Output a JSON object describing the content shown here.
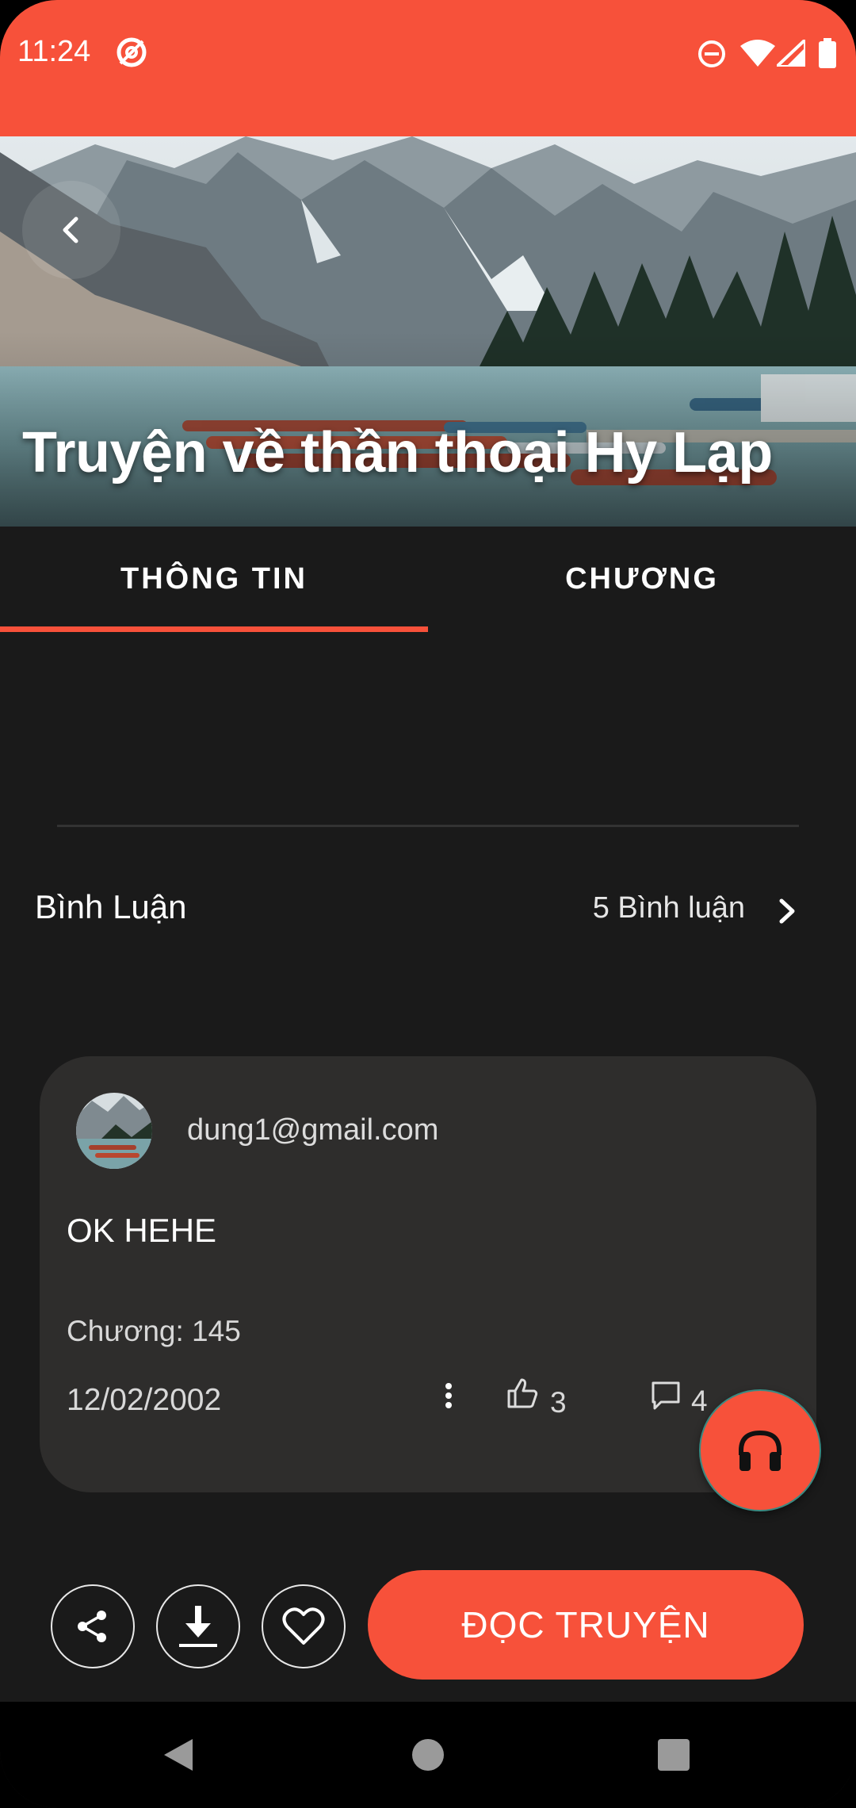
{
  "status_bar": {
    "time": "11:24",
    "icons": [
      "at-sign-icon",
      "do-not-disturb-icon",
      "wifi-icon",
      "signal-icon",
      "battery-icon"
    ]
  },
  "hero": {
    "title": "Truyện về thần thoại Hy Lạp",
    "back_icon": "chevron-left-icon"
  },
  "tabs": [
    {
      "label": "THÔNG TIN",
      "selected": true
    },
    {
      "label": "CHƯƠNG",
      "selected": false
    }
  ],
  "comments": {
    "title": "Bình Luận",
    "count_label": "5 Bình luận",
    "items": [
      {
        "user": "dung1@gmail.com",
        "text": "OK HEHE",
        "chapter": "Chương: 145",
        "date": "12/02/2002",
        "likes": "3",
        "replies": "4"
      }
    ]
  },
  "fab": {
    "icon": "headphones-icon"
  },
  "actions": {
    "share_icon": "share-icon",
    "download_icon": "download-icon",
    "favorite_icon": "heart-icon",
    "read_label": "ĐỌC TRUYỆN"
  },
  "nav": [
    "back-triangle-icon",
    "home-circle-icon",
    "recents-square-icon"
  ],
  "colors": {
    "accent": "#f7513a",
    "background": "#1a1a1a",
    "card": "#2e2d2c"
  }
}
